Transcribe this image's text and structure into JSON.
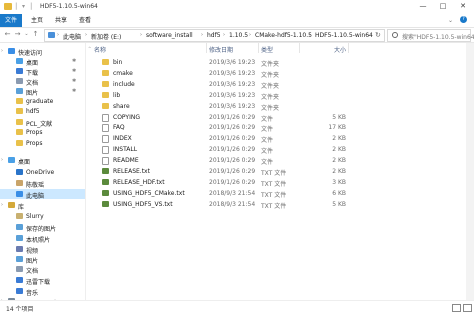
{
  "window": {
    "title": "HDF5-1.10.5-win64",
    "controls": [
      "—",
      "□",
      "✕"
    ]
  },
  "ribbon": {
    "tabs": [
      "文件",
      "主页",
      "共享",
      "查看"
    ]
  },
  "address": {
    "crumbs": [
      "此电脑",
      "新加卷 (E:)",
      "software_install",
      "hdf5",
      "1.10.5",
      "CMake-hdf5-1.10.5",
      "HDF5-1.10.5-win64"
    ],
    "search_placeholder": "搜索\"HDF5-1.10.5-win64\""
  },
  "sidebar": {
    "items": [
      {
        "label": "快速访问",
        "icon": "star-icon",
        "color": "#3a8ee6",
        "pinned": false
      },
      {
        "label": "桌面",
        "icon": "desktop-icon",
        "color": "#4aa0e6",
        "pinned": true
      },
      {
        "label": "下载",
        "icon": "download-icon",
        "color": "#3a7bd5",
        "pinned": true
      },
      {
        "label": "文档",
        "icon": "document-icon",
        "color": "#8a9ab0",
        "pinned": true
      },
      {
        "label": "图片",
        "icon": "picture-icon",
        "color": "#5aa0d8",
        "pinned": true
      },
      {
        "label": "graduate",
        "icon": "folder-icon",
        "color": "#e9c14a",
        "pinned": false
      },
      {
        "label": "hdf5",
        "icon": "folder-icon",
        "color": "#e9c14a",
        "pinned": false
      },
      {
        "label": "PCL_文献",
        "icon": "folder-icon",
        "color": "#e9c14a",
        "pinned": false
      },
      {
        "label": "Props",
        "icon": "folder-icon",
        "color": "#e9c14a",
        "pinned": false
      },
      {
        "label": "Props",
        "icon": "folder-icon",
        "color": "#e9c14a",
        "pinned": false
      },
      {
        "label": "桌面",
        "icon": "desktop-icon",
        "color": "#4aa0e6",
        "pinned": false
      },
      {
        "label": "OneDrive",
        "icon": "cloud-icon",
        "color": "#2a74c9",
        "pinned": false
      },
      {
        "label": "陈敬瑶",
        "icon": "user-icon",
        "color": "#c9a46a",
        "pinned": false
      },
      {
        "label": "此电脑",
        "icon": "computer-icon",
        "color": "#3a8ee6",
        "pinned": false
      },
      {
        "label": "库",
        "icon": "library-icon",
        "color": "#d4a93a",
        "pinned": false
      },
      {
        "label": "Slurry",
        "icon": "library-folder-icon",
        "color": "#c8b070",
        "pinned": false
      },
      {
        "label": "保存的图片",
        "icon": "picture-icon",
        "color": "#5aa0d8",
        "pinned": false
      },
      {
        "label": "本机照片",
        "icon": "picture-icon",
        "color": "#5aa0d8",
        "pinned": false
      },
      {
        "label": "视频",
        "icon": "video-icon",
        "color": "#6a7bb0",
        "pinned": false
      },
      {
        "label": "图片",
        "icon": "picture-icon",
        "color": "#5aa0d8",
        "pinned": false
      },
      {
        "label": "文档",
        "icon": "document-icon",
        "color": "#8a9ab0",
        "pinned": false
      },
      {
        "label": "迅雷下载",
        "icon": "download-icon",
        "color": "#3a7bd5",
        "pinned": false
      },
      {
        "label": "音乐",
        "icon": "music-icon",
        "color": "#3a7bd5",
        "pinned": false
      },
      {
        "label": "BD-ROM 驱动器 (F:)",
        "icon": "disc-drive-icon",
        "color": "#7a8a9a",
        "pinned": false
      }
    ]
  },
  "columns": {
    "name": "名称",
    "date": "修改日期",
    "type": "类型",
    "size": "大小"
  },
  "files": [
    {
      "name": "bin",
      "date": "2019/3/6 19:23",
      "type": "文件夹",
      "size": "",
      "kind": "folder"
    },
    {
      "name": "cmake",
      "date": "2019/3/6 19:23",
      "type": "文件夹",
      "size": "",
      "kind": "folder"
    },
    {
      "name": "include",
      "date": "2019/3/6 19:23",
      "type": "文件夹",
      "size": "",
      "kind": "folder"
    },
    {
      "name": "lib",
      "date": "2019/3/6 19:23",
      "type": "文件夹",
      "size": "",
      "kind": "folder"
    },
    {
      "name": "share",
      "date": "2019/3/6 19:23",
      "type": "文件夹",
      "size": "",
      "kind": "folder"
    },
    {
      "name": "COPYING",
      "date": "2019/1/26 0:29",
      "type": "文件",
      "size": "5 KB",
      "kind": "file"
    },
    {
      "name": "FAQ",
      "date": "2019/1/26 0:29",
      "type": "文件",
      "size": "17 KB",
      "kind": "file"
    },
    {
      "name": "INDEX",
      "date": "2019/1/26 0:29",
      "type": "文件",
      "size": "2 KB",
      "kind": "file"
    },
    {
      "name": "INSTALL",
      "date": "2019/1/26 0:29",
      "type": "文件",
      "size": "2 KB",
      "kind": "file"
    },
    {
      "name": "README",
      "date": "2019/1/26 0:29",
      "type": "文件",
      "size": "2 KB",
      "kind": "file"
    },
    {
      "name": "RELEASE.txt",
      "date": "2019/1/26 0:29",
      "type": "TXT 文件",
      "size": "2 KB",
      "kind": "txt"
    },
    {
      "name": "RELEASE_HDF.txt",
      "date": "2019/1/26 0:29",
      "type": "TXT 文件",
      "size": "3 KB",
      "kind": "txt"
    },
    {
      "name": "USING_HDF5_CMake.txt",
      "date": "2018/9/3 21:54",
      "type": "TXT 文件",
      "size": "6 KB",
      "kind": "txt"
    },
    {
      "name": "USING_HDF5_VS.txt",
      "date": "2018/9/3 21:54",
      "type": "TXT 文件",
      "size": "5 KB",
      "kind": "txt"
    }
  ],
  "status": {
    "count": "14 个项目"
  }
}
